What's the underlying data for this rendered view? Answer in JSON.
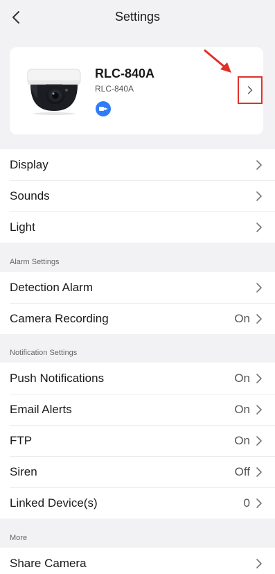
{
  "header": {
    "title": "Settings"
  },
  "device": {
    "name": "RLC-840A",
    "model": "RLC-840A"
  },
  "colors": {
    "accent": "#2f7cf6",
    "annotation": "#e0302a"
  },
  "groups": {
    "general": {
      "items": [
        {
          "label": "Display",
          "value": ""
        },
        {
          "label": "Sounds",
          "value": ""
        },
        {
          "label": "Light",
          "value": ""
        }
      ]
    },
    "alarm": {
      "section_label": "Alarm Settings",
      "items": [
        {
          "label": "Detection Alarm",
          "value": ""
        },
        {
          "label": "Camera Recording",
          "value": "On"
        }
      ]
    },
    "notification": {
      "section_label": "Notification Settings",
      "items": [
        {
          "label": "Push Notifications",
          "value": "On"
        },
        {
          "label": "Email Alerts",
          "value": "On"
        },
        {
          "label": "FTP",
          "value": "On"
        },
        {
          "label": "Siren",
          "value": "Off"
        },
        {
          "label": "Linked Device(s)",
          "value": "0"
        }
      ]
    },
    "more": {
      "section_label": "More",
      "items": [
        {
          "label": "Share Camera",
          "value": ""
        }
      ]
    }
  }
}
